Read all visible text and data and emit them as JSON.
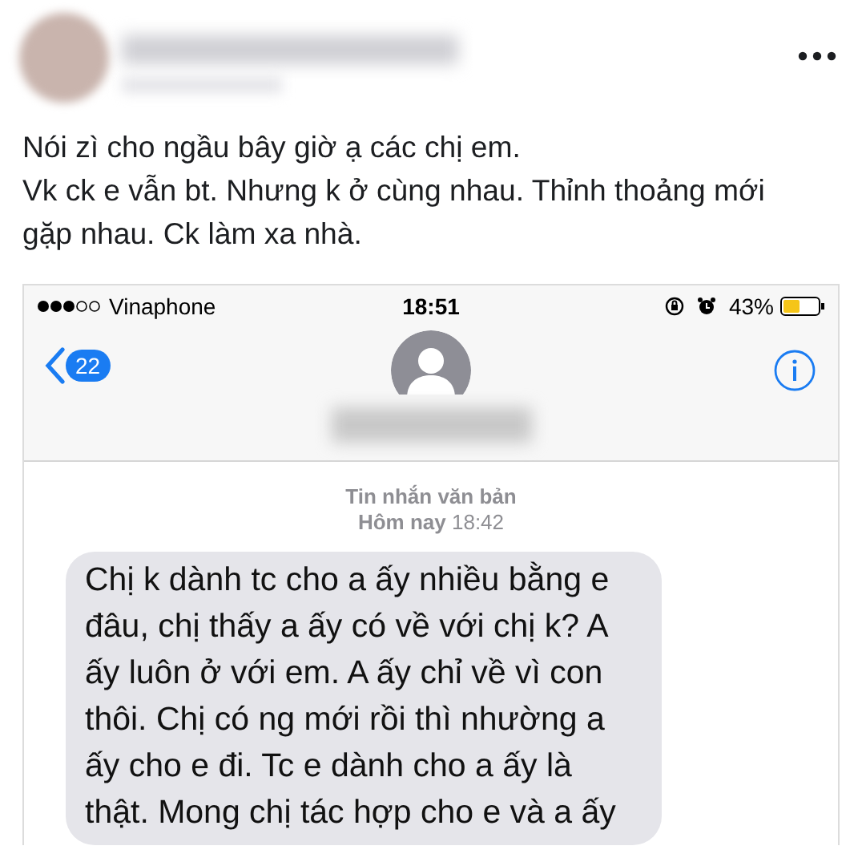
{
  "post": {
    "paragraphs": [
      "Nói zì cho ngầu bây giờ ạ các chị em.",
      "Vk ck e vẫn bt. Nhưng k ở cùng nhau. Thỉnh thoảng mới gặp nhau. Ck làm xa nhà."
    ]
  },
  "phone": {
    "status_bar": {
      "carrier": "Vinaphone",
      "time": "18:51",
      "battery": "43%"
    },
    "nav": {
      "back_count": "22"
    },
    "thread": {
      "label": "Tin nhắn văn bản",
      "day": "Hôm nay",
      "time": "18:42"
    },
    "messages": [
      {
        "text": "Chị k dành tc cho a ấy nhiều bằng e đâu, chị thấy a ấy có về với chị k? A ấy luôn ở với em. A ấy chỉ về vì con thôi. Chị có ng mới rồi thì nhường a ấy cho e đi. Tc e dành cho a ấy là thật. Mong chị tác hợp cho e và a ấy"
      }
    ]
  }
}
